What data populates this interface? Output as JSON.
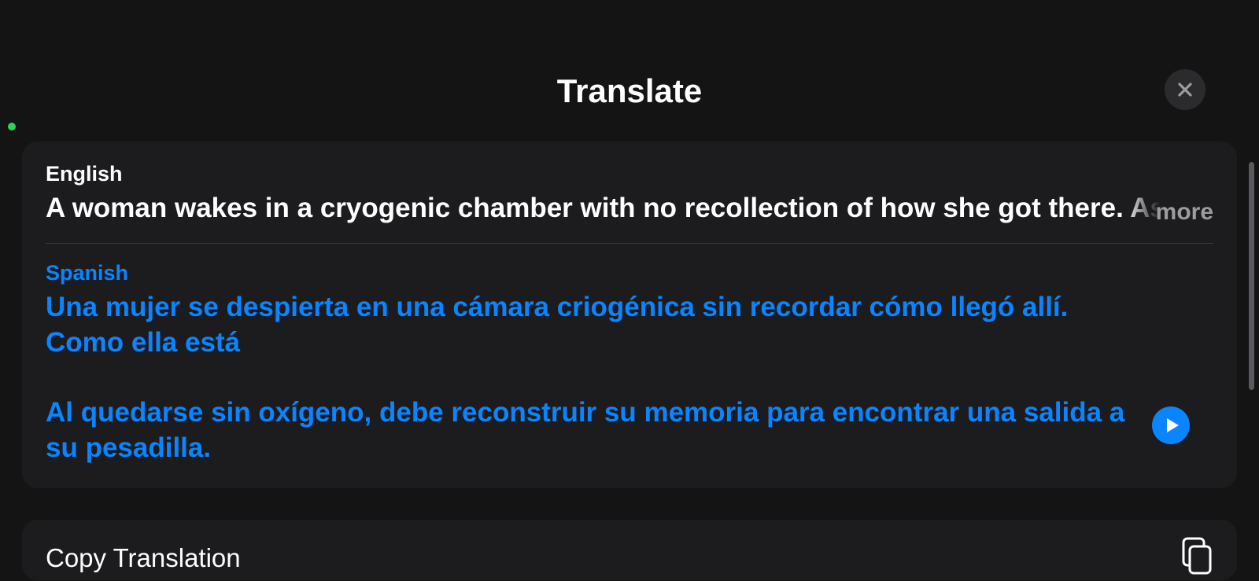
{
  "header": {
    "title": "Translate"
  },
  "source": {
    "lang_label": "English",
    "text": "A woman wakes in a cryogenic chamber with no recollection of how she got there. As s",
    "more_label": "more"
  },
  "target": {
    "lang_label": "Spanish",
    "text": "Una mujer se despierta en una cámara criogénica sin recordar cómo llegó allí. Como ella está\n\nAl quedarse sin oxígeno, debe reconstruir su memoria para encontrar una salida a su pesadilla."
  },
  "actions": {
    "copy_label": "Copy Translation"
  }
}
